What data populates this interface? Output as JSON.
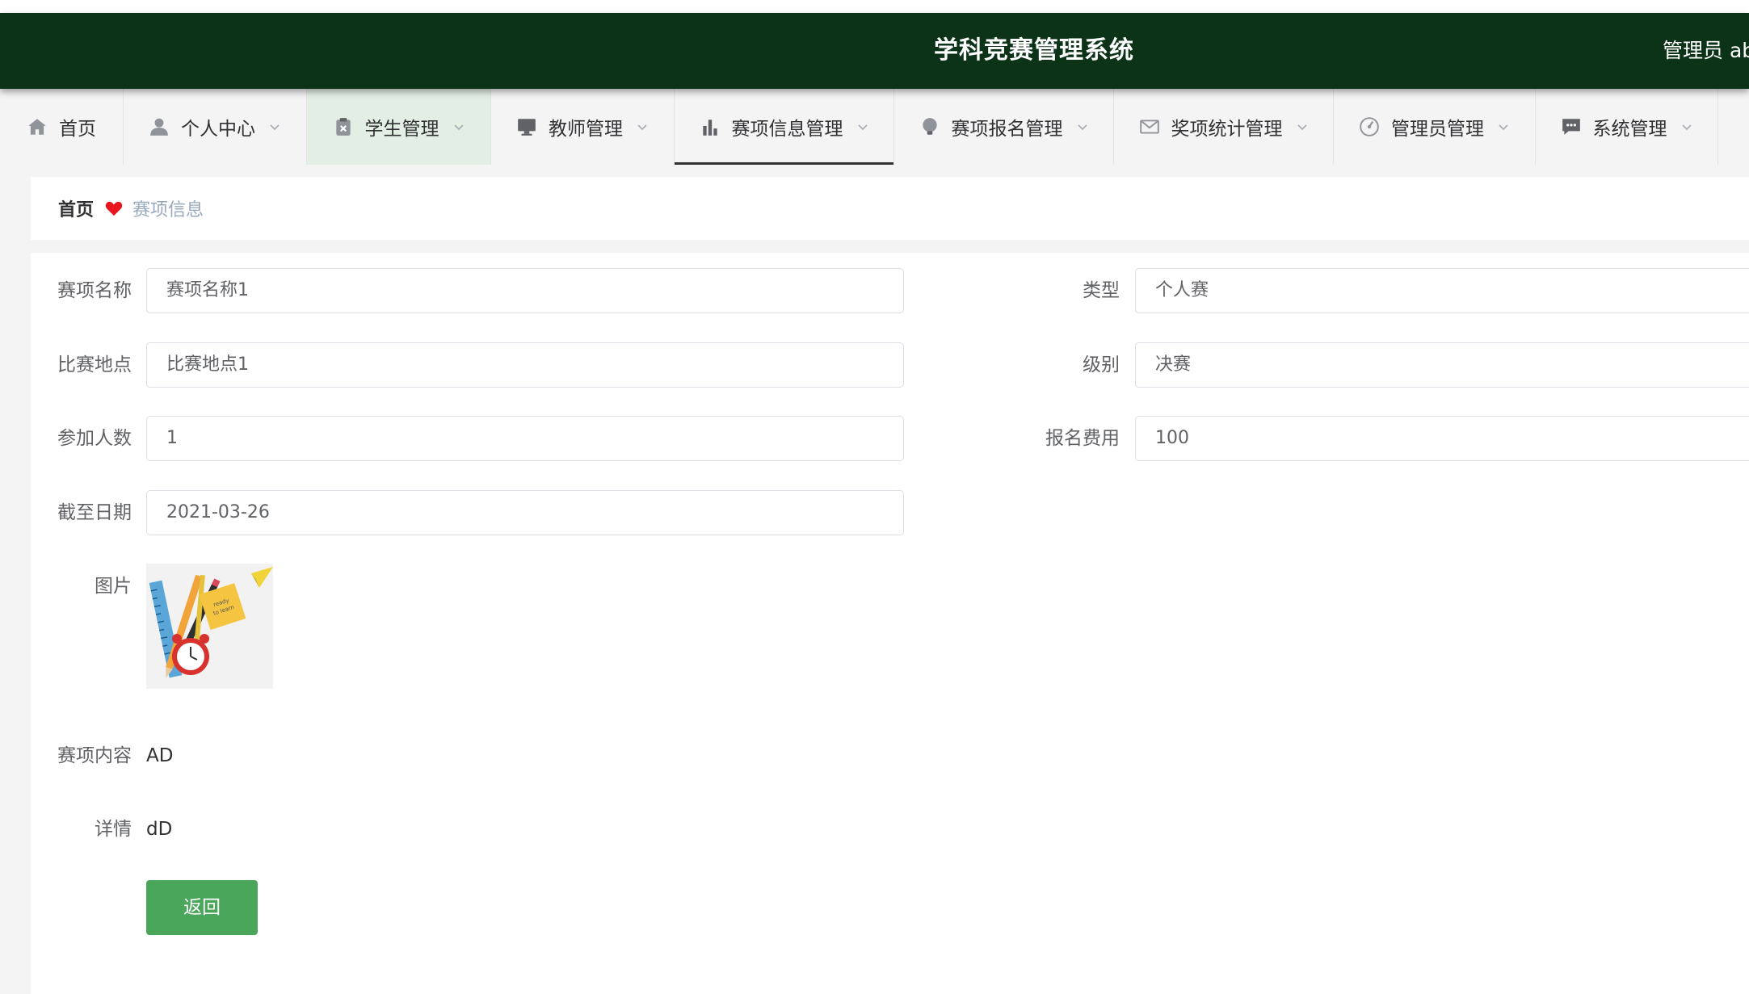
{
  "header": {
    "title": "学科竞赛管理系统",
    "user_label": "管理员 ab"
  },
  "nav": [
    {
      "label": "首页",
      "icon": "home-icon",
      "has_dropdown": false
    },
    {
      "label": "个人中心",
      "icon": "user-icon",
      "has_dropdown": true
    },
    {
      "label": "学生管理",
      "icon": "clipboard-icon",
      "has_dropdown": true
    },
    {
      "label": "教师管理",
      "icon": "monitor-icon",
      "has_dropdown": true
    },
    {
      "label": "赛项信息管理",
      "icon": "bar-chart-icon",
      "has_dropdown": true
    },
    {
      "label": "赛项报名管理",
      "icon": "bulb-icon",
      "has_dropdown": true
    },
    {
      "label": "奖项统计管理",
      "icon": "mail-icon",
      "has_dropdown": true
    },
    {
      "label": "管理员管理",
      "icon": "gauge-icon",
      "has_dropdown": true
    },
    {
      "label": "系统管理",
      "icon": "chat-icon",
      "has_dropdown": true
    }
  ],
  "breadcrumb": {
    "home": "首页",
    "current": "赛项信息"
  },
  "form": {
    "name_label": "赛项名称",
    "name_value": "赛项名称1",
    "type_label": "类型",
    "type_value": "个人赛",
    "location_label": "比赛地点",
    "location_value": "比赛地点1",
    "level_label": "级别",
    "level_value": "决赛",
    "participants_label": "参加人数",
    "participants_value": "1",
    "fee_label": "报名费用",
    "fee_value": "100",
    "deadline_label": "截至日期",
    "deadline_value": "2021-03-26",
    "image_label": "图片",
    "content_label": "赛项内容",
    "content_value": "AD",
    "detail_label": "详情",
    "detail_value": "dD",
    "back_label": "返回"
  },
  "colors": {
    "header_bg": "#0c3318",
    "button_green": "#4aa65b",
    "heart_red": "#e8141e"
  }
}
